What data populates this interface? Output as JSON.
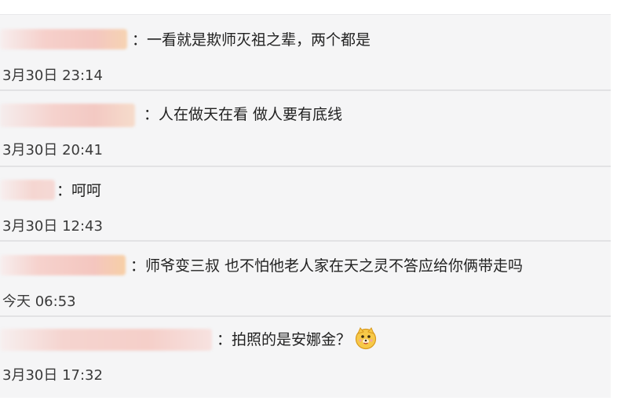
{
  "comments": [
    {
      "text": "：一看就是欺师灭祖之辈，两个都是",
      "time": "3月30日 23:14"
    },
    {
      "text": "：人在做天在看 做人要有底线",
      "time": "3月30日 20:41"
    },
    {
      "text": "：呵呵",
      "time": "3月30日 12:43"
    },
    {
      "text": "：师爷变三叔 也不怕他老人家在天之灵不答应给你俩带走吗",
      "time": "今天 06:53"
    },
    {
      "text": "：拍照的是安娜金？",
      "time": "3月30日 17:32",
      "emoji": "dog-face-emoji"
    }
  ],
  "colors": {
    "background": "#f5f5f6",
    "separator": "#e2e2e4",
    "text": "#222222",
    "timestamp": "#3a3a3a",
    "blur_pink": "#f6c7c2",
    "blur_peach": "#f8d3b0",
    "emoji_yellow": "#f7c948"
  }
}
